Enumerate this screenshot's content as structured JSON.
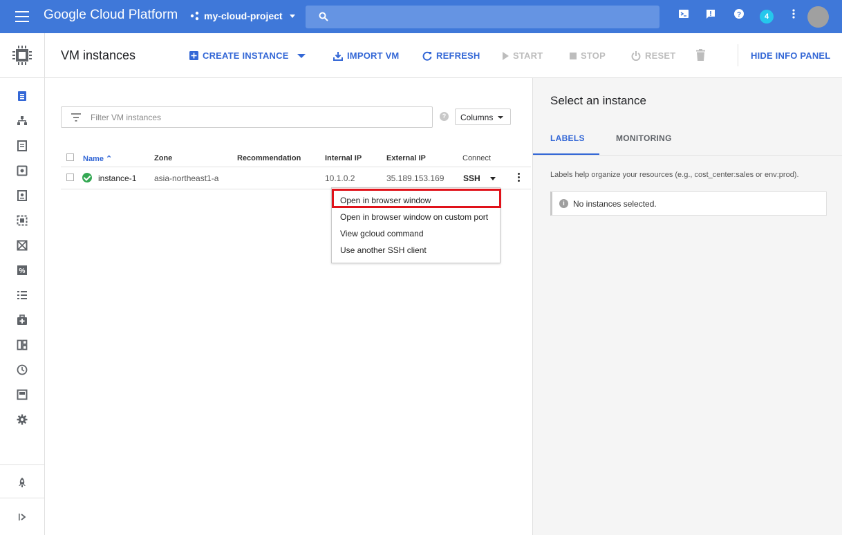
{
  "topbar": {
    "brand": "Google Cloud Platform",
    "project": "my-cloud-project",
    "notification_count": "4"
  },
  "toolbar": {
    "title": "VM instances",
    "create_instance": "CREATE INSTANCE",
    "import_vm": "IMPORT VM",
    "refresh": "REFRESH",
    "start": "START",
    "stop": "STOP",
    "reset": "RESET",
    "hide_info_panel": "HIDE INFO PANEL"
  },
  "filter": {
    "placeholder": "Filter VM instances",
    "columns_label": "Columns"
  },
  "table": {
    "headers": {
      "name": "Name",
      "zone": "Zone",
      "recommendation": "Recommendation",
      "internal_ip": "Internal IP",
      "external_ip": "External IP",
      "connect": "Connect"
    },
    "rows": [
      {
        "name": "instance-1",
        "zone": "asia-northeast1-a",
        "recommendation": "",
        "internal_ip": "10.1.0.2",
        "external_ip": "35.189.153.169",
        "connect": "SSH"
      }
    ]
  },
  "ssh_menu": {
    "items": [
      "Open in browser window",
      "Open in browser window on custom port",
      "View gcloud command",
      "Use another SSH client"
    ]
  },
  "info_panel": {
    "title": "Select an instance",
    "tabs": [
      "LABELS",
      "MONITORING"
    ],
    "help_text": "Labels help organize your resources (e.g., cost_center:sales or env:prod).",
    "notice": "No instances selected."
  },
  "colors": {
    "topbar": "#3f78d9",
    "accent": "#3367d6",
    "highlight": "#e0121a",
    "status_ok": "#34a853"
  }
}
